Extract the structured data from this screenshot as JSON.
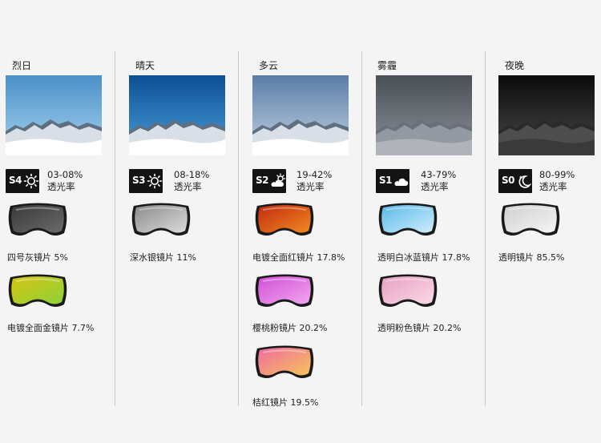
{
  "columns": [
    {
      "title": "烈日",
      "code": "S4",
      "weather_icon": "sun-icon",
      "range": "03-08%",
      "transmittance_label": "透光率",
      "sky_colors": [
        "#4a90c8",
        "#a8d4f0"
      ],
      "lenses": [
        {
          "label": "四号灰镜片 5%",
          "icon": "goggle-icon",
          "colors": [
            "#3a3a3a",
            "#6a6a6a"
          ]
        },
        {
          "label": "电镀全面金镜片 7.7%",
          "icon": "goggle-icon",
          "colors": [
            "#d6c410",
            "#8dd23a"
          ]
        }
      ]
    },
    {
      "title": "晴天",
      "code": "S3",
      "weather_icon": "sun-icon",
      "range": "08-18%",
      "transmittance_label": "透光率",
      "sky_colors": [
        "#0d4f93",
        "#4aa0dc"
      ],
      "lenses": [
        {
          "label": "深水银镜片 11%",
          "icon": "goggle-icon",
          "colors": [
            "#8a8a8a",
            "#dcdcdc"
          ]
        }
      ]
    },
    {
      "title": "多云",
      "code": "S2",
      "weather_icon": "partly-cloudy-icon",
      "range": "19-42%",
      "transmittance_label": "透光率",
      "sky_colors": [
        "#5a7ea8",
        "#c3d2e2"
      ],
      "lenses": [
        {
          "label": "电镀全面红镜片 17.8%",
          "icon": "goggle-icon",
          "colors": [
            "#c22a10",
            "#f08a20"
          ]
        },
        {
          "label": "樱桃粉镜片 20.2%",
          "icon": "goggle-icon",
          "colors": [
            "#d050d8",
            "#f3a6ee"
          ]
        },
        {
          "label": "桔红镜片 19.5%",
          "icon": "goggle-icon",
          "colors": [
            "#f06aa0",
            "#f6c45a"
          ]
        }
      ]
    },
    {
      "title": "雾霾",
      "code": "S1",
      "weather_icon": "cloud-icon",
      "range": "43-79%",
      "transmittance_label": "透光率",
      "sky_colors": [
        "#4a4e55",
        "#8e949c"
      ],
      "lenses": [
        {
          "label": "透明白冰蓝镜片 17.8%",
          "icon": "goggle-icon",
          "colors": [
            "#5ab8e8",
            "#cfeefc"
          ]
        },
        {
          "label": "透明粉色镜片 20.2%",
          "icon": "goggle-icon",
          "colors": [
            "#e8a0c2",
            "#fbd8e6"
          ]
        }
      ]
    },
    {
      "title": "夜晚",
      "code": "S0",
      "weather_icon": "moon-star-icon",
      "range": "80-99%",
      "transmittance_label": "透光率",
      "sky_colors": [
        "#0a0a0a",
        "#4a4a4a"
      ],
      "lenses": [
        {
          "label": "透明镜片 85.5%",
          "icon": "goggle-icon",
          "colors": [
            "#d0d0d0",
            "#f4f4f4"
          ]
        }
      ]
    }
  ]
}
